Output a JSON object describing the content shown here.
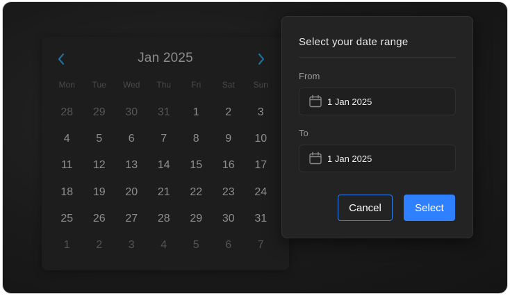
{
  "calendar": {
    "month_label": "Jan 2025",
    "weekdays": [
      "Mon",
      "Tue",
      "Wed",
      "Thu",
      "Fri",
      "Sat",
      "Sun"
    ],
    "days": [
      {
        "label": "28",
        "outside": true
      },
      {
        "label": "29",
        "outside": true
      },
      {
        "label": "30",
        "outside": true
      },
      {
        "label": "31",
        "outside": true
      },
      {
        "label": "1",
        "outside": false
      },
      {
        "label": "2",
        "outside": false
      },
      {
        "label": "3",
        "outside": false
      },
      {
        "label": "4",
        "outside": false
      },
      {
        "label": "5",
        "outside": false
      },
      {
        "label": "6",
        "outside": false
      },
      {
        "label": "7",
        "outside": false
      },
      {
        "label": "8",
        "outside": false
      },
      {
        "label": "9",
        "outside": false
      },
      {
        "label": "10",
        "outside": false
      },
      {
        "label": "11",
        "outside": false
      },
      {
        "label": "12",
        "outside": false
      },
      {
        "label": "13",
        "outside": false
      },
      {
        "label": "14",
        "outside": false
      },
      {
        "label": "15",
        "outside": false
      },
      {
        "label": "16",
        "outside": false
      },
      {
        "label": "17",
        "outside": false
      },
      {
        "label": "18",
        "outside": false
      },
      {
        "label": "19",
        "outside": false
      },
      {
        "label": "20",
        "outside": false
      },
      {
        "label": "21",
        "outside": false
      },
      {
        "label": "22",
        "outside": false
      },
      {
        "label": "23",
        "outside": false
      },
      {
        "label": "24",
        "outside": false
      },
      {
        "label": "25",
        "outside": false
      },
      {
        "label": "26",
        "outside": false
      },
      {
        "label": "27",
        "outside": false
      },
      {
        "label": "28",
        "outside": false
      },
      {
        "label": "29",
        "outside": false
      },
      {
        "label": "30",
        "outside": false
      },
      {
        "label": "31",
        "outside": false
      },
      {
        "label": "1",
        "outside": true
      },
      {
        "label": "2",
        "outside": true
      },
      {
        "label": "3",
        "outside": true
      },
      {
        "label": "4",
        "outside": true
      },
      {
        "label": "5",
        "outside": true
      },
      {
        "label": "6",
        "outside": true
      },
      {
        "label": "7",
        "outside": true
      }
    ],
    "prev_icon": "chevron-left-icon",
    "next_icon": "chevron-right-icon",
    "nav_color": "#1f6f9a"
  },
  "dialog": {
    "title": "Select your date range",
    "from_label": "From",
    "from_value": "1 Jan 2025",
    "to_label": "To",
    "to_value": "1 Jan 2025",
    "field_icon": "calendar-icon",
    "cancel_label": "Cancel",
    "select_label": "Select",
    "accent_color": "#2f80ff"
  }
}
